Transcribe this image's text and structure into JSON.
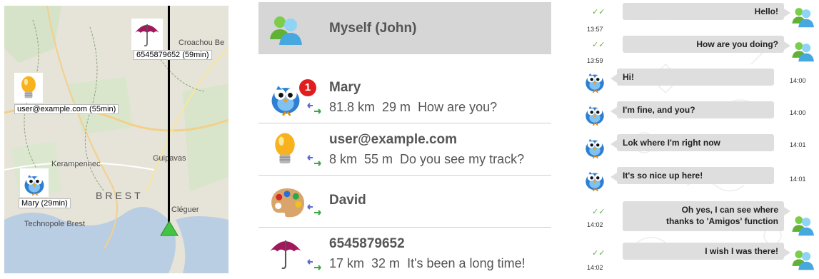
{
  "map": {
    "places": {
      "croachou": "Croachou Be",
      "guipavas": "Guipavas",
      "kerampennec": "Kerampennec",
      "brest": "BREST",
      "cleguer": "Cléguer",
      "technopole": "Technopole Brest"
    },
    "markers": [
      {
        "icon": "umbrella-icon",
        "label": "6545879652 (59min)"
      },
      {
        "icon": "lightbulb-icon",
        "label": "user@example.com (55min)"
      },
      {
        "icon": "bird-avatar-icon",
        "label": "Mary (29min)"
      }
    ]
  },
  "contacts": {
    "header": {
      "title": "Myself (John)"
    },
    "items": [
      {
        "name": "Mary",
        "distance": "81.8 km",
        "time": "29 m",
        "message": "How are you?",
        "badge": "1",
        "icon": "bird-avatar-icon"
      },
      {
        "name": "user@example.com",
        "distance": "8 km",
        "time": "55 m",
        "message": "Do you see my track?",
        "icon": "lightbulb-icon"
      },
      {
        "name": "David",
        "distance": "",
        "time": "",
        "message": "",
        "icon": "palette-icon"
      },
      {
        "name": "6545879652",
        "distance": "17 km",
        "time": "32 m",
        "message": "It's been a long time!",
        "icon": "umbrella-icon"
      }
    ]
  },
  "chat": {
    "messages": [
      {
        "dir": "out",
        "text": "Hello!",
        "time": "13:57"
      },
      {
        "dir": "out",
        "text": "How are you doing?",
        "time": "13:59"
      },
      {
        "dir": "in",
        "text": "Hi!",
        "time": "14:00"
      },
      {
        "dir": "in",
        "text": "I'm fine, and you?",
        "time": "14:00"
      },
      {
        "dir": "in",
        "text": "Lok where I'm right now",
        "time": "14:01"
      },
      {
        "dir": "in",
        "text": "It's so nice up here!",
        "time": "14:01"
      },
      {
        "dir": "out",
        "text": "Oh yes, I can see where",
        "text2": "thanks to 'Amigos' function",
        "time": "14:02"
      },
      {
        "dir": "out",
        "text": "I wish I was there!",
        "time": "14:02"
      }
    ],
    "colors": {
      "bubble": "#dedede",
      "tick": "#6ab04c"
    }
  }
}
